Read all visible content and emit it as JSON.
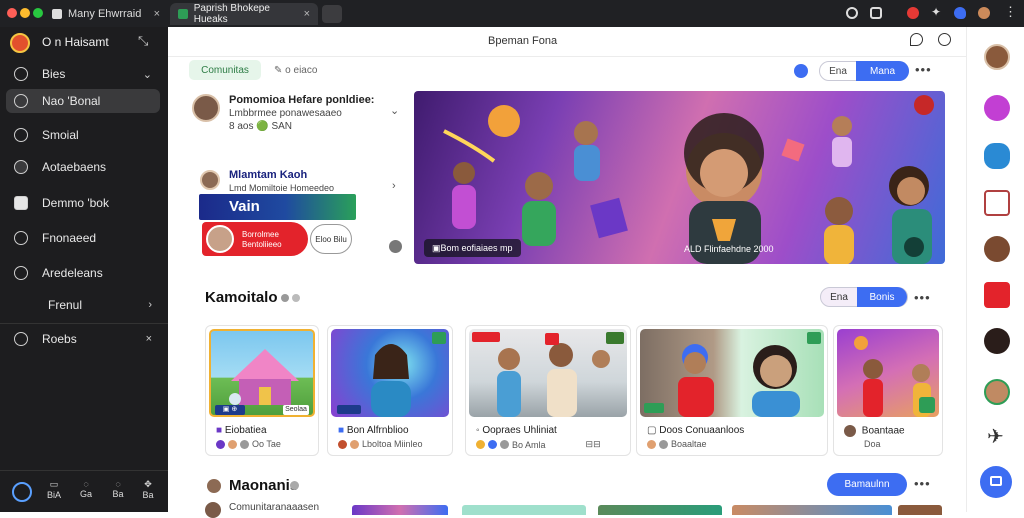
{
  "browser": {
    "tabs": [
      {
        "label": "Many Ehwrraid",
        "active": false
      },
      {
        "label": "Paprish Bhokepe Hueaks",
        "active": true
      }
    ]
  },
  "sidebar": {
    "brand": "O n Haisamt",
    "items": [
      {
        "label": "Bies",
        "chevron": "⌄"
      },
      {
        "label": "Nao 'Bonal",
        "active": true
      },
      {
        "label": "Smoial"
      },
      {
        "label": "Aotaebaens"
      },
      {
        "label": "Demmo 'bok"
      },
      {
        "label": "Fnonaeed"
      },
      {
        "label": "Aredeleans"
      },
      {
        "label": "Frenul",
        "chevron": "›"
      },
      {
        "label": "Roebs",
        "chevron": "×"
      }
    ],
    "footer": [
      "BiA",
      "Ga",
      "Ba",
      "Ba"
    ]
  },
  "topbar": {
    "title": "Bpeman Fona"
  },
  "filter": {
    "chip": "Comunitas",
    "secondary": "o eiaco"
  },
  "header_buttons": {
    "primary": "Mana",
    "secondary": "Ena"
  },
  "feed": {
    "post1": {
      "line1": "Pomomioa Hefare ponldiee:",
      "line2": "Lmbbrmee ponawesaaeo",
      "line3": "8 aos 🟢 SAN"
    },
    "post2": {
      "name": "Mlamtam Kaoh",
      "sub": "Lmd Momiltoie Homeedeo",
      "banner": "Vain",
      "promo": "Borrolmee Bentoliieeo",
      "badge": "Eloo Bilu"
    }
  },
  "hero": {
    "caption": "Bom eofiaiaes mp",
    "stats": "ALD Flinfaehdne 2000"
  },
  "section1": {
    "title": "Kamoitalo",
    "btn_secondary": "Ena",
    "btn_primary": "Bonis",
    "cards": [
      {
        "title": "Eiobatiea",
        "meta": "Oo Tae",
        "tag": "Seolaa"
      },
      {
        "title": "Bon Alfrnblioo",
        "meta": "Lboltoa Miinleo",
        "tag": ""
      },
      {
        "title": "Oopraes Uhliniat",
        "meta": "Bo Amla",
        "tag": ""
      },
      {
        "title": "Doos Conuaanloos",
        "meta": "Boaaltae",
        "tag": ""
      },
      {
        "title": "Boantaae",
        "meta": "Doa",
        "tag": ""
      }
    ]
  },
  "section2": {
    "title": "Maonanis",
    "btn_primary": "Bamaulnn",
    "snippet": "Comunitaranaaasen"
  },
  "colors": {
    "accent": "#3d6df2",
    "sidebar_bg": "#1d1d1f",
    "chrome_bg": "#202124",
    "green": "#2e9d56"
  }
}
